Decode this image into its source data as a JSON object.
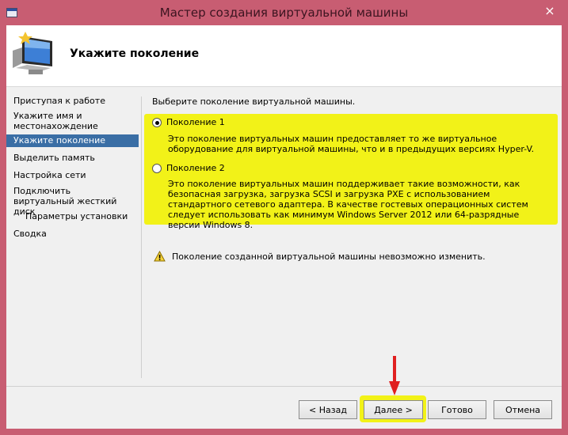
{
  "window": {
    "title": "Мастер создания виртуальной машины",
    "close_glyph": "×"
  },
  "header": {
    "title": "Укажите поколение",
    "icon": "wizard-monitor-icon"
  },
  "nav": {
    "items": [
      {
        "label": "Приступая к работе"
      },
      {
        "label": "Укажите имя и местонахождение"
      },
      {
        "label": "Укажите поколение"
      },
      {
        "label": "Выделить память"
      },
      {
        "label": "Настройка сети"
      },
      {
        "label": "Подключить виртуальный жесткий диск"
      },
      {
        "label": "Параметры установки"
      },
      {
        "label": "Сводка"
      }
    ]
  },
  "content": {
    "prompt": "Выберите поколение виртуальной машины.",
    "option1": {
      "label": "Поколение 1",
      "selected": true,
      "description": "Это поколение виртуальных машин предоставляет то же виртуальное оборудование для виртуальной машины, что и в предыдущих версиях Hyper-V."
    },
    "option2": {
      "label": "Поколение 2",
      "selected": false,
      "description": "Это поколение виртуальных машин поддерживает такие возможности, как безопасная загрузка, загрузка SCSI и загрузка PXE с использованием стандартного сетевого адаптера. В качестве гостевых операционных систем следует использовать как минимум Windows Server 2012 или 64-разрядные версии Windows 8."
    },
    "warning": "Поколение созданной виртуальной машины невозможно изменить."
  },
  "buttons": {
    "back": "< Назад",
    "next": "Далее >",
    "finish": "Готово",
    "cancel": "Отмена"
  },
  "colors": {
    "titlebar": "#c85d72",
    "highlight": "#f2f218",
    "nav_active": "#3a6ea5",
    "arrow": "#e02020"
  }
}
